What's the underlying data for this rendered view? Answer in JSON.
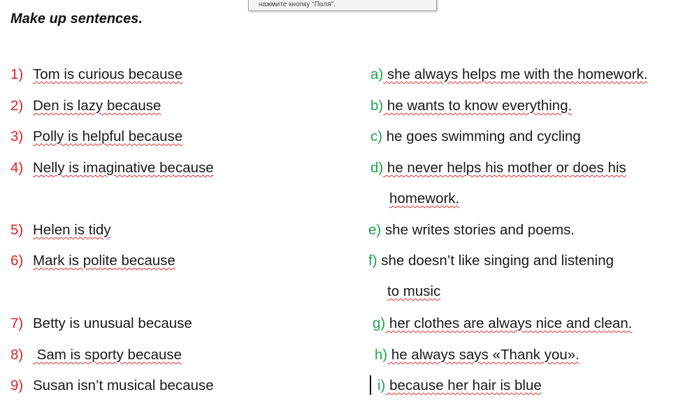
{
  "tooltip": "нажмите кнопку \"Поля\".",
  "title": "Make up sentences.",
  "left": [
    {
      "num": "1)",
      "text": "Tom is curious because"
    },
    {
      "num": "2)",
      "text": "Den is lazy because"
    },
    {
      "num": "3)",
      "text": "Polly is helpful because"
    },
    {
      "num": "4)",
      "text": "Nelly is imaginative because"
    },
    {
      "num": "5)",
      "text": "Helen is tidy"
    },
    {
      "num": "6)",
      "text": "Mark is polite because"
    },
    {
      "num": "7)",
      "text": "Betty is unusual because"
    },
    {
      "num": "8)",
      "text": " Sam is sporty  because"
    },
    {
      "num": "9)",
      "text": "Susan isn’t musical because"
    }
  ],
  "right": [
    {
      "letter": "a)",
      "text": " she always helps me with the  homework."
    },
    {
      "letter": "b)",
      "text": " he wants to know everything."
    },
    {
      "letter": "c)",
      "text": "  he goes swimming and cycling"
    },
    {
      "letter": "d)",
      "text": " he never helps his mother or does his"
    },
    {
      "letter": "",
      "text": "homework."
    },
    {
      "letter": "e)",
      "text": " she writes stories and poems."
    },
    {
      "letter": "f)",
      "text": " she doesn’t like singing and listening"
    },
    {
      "letter": "",
      "text": "to music"
    },
    {
      "letter": "g)",
      "text": " her clothes are always nice and clean."
    },
    {
      "letter": "h)",
      "text": "   he always says «Thank you»."
    },
    {
      "letter": "i)",
      "text": "  because her hair is blue"
    }
  ]
}
